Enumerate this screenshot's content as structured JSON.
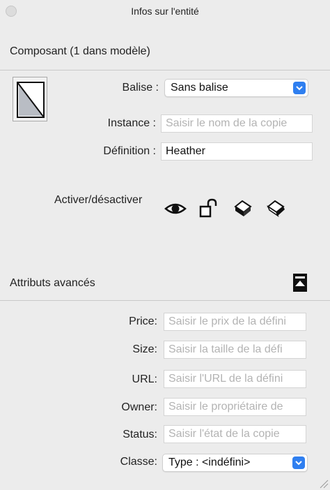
{
  "window": {
    "title": "Infos sur l'entité"
  },
  "component": {
    "header": "Composant (1 dans modèle)",
    "balise_label": "Balise :",
    "balise_value": "Sans balise",
    "instance_label": "Instance :",
    "instance_placeholder": "Saisir le nom de la copie",
    "definition_label": "Définition :",
    "definition_value": "Heather",
    "toggle_label": "Activer/désactiver",
    "toggle_icons": [
      "eye-icon",
      "lock-icon",
      "cast-shadow-icon",
      "receive-shadow-icon"
    ]
  },
  "advanced": {
    "header": "Attributs avancés",
    "fields": [
      {
        "label": "Price:",
        "placeholder": "Saisir le prix de la défini"
      },
      {
        "label": "Size:",
        "placeholder": "Saisir la taille de la défi"
      },
      {
        "label": "URL:",
        "placeholder": "Saisir l'URL de la défini"
      },
      {
        "label": "Owner:",
        "placeholder": "Saisir le propriétaire de"
      },
      {
        "label": "Status:",
        "placeholder": "Saisir l'état de la copie"
      }
    ],
    "classe_label": "Classe:",
    "classe_value": "Type : <indéfini>"
  },
  "colors": {
    "accent": "#2f7ff0",
    "background": "#ececec"
  }
}
